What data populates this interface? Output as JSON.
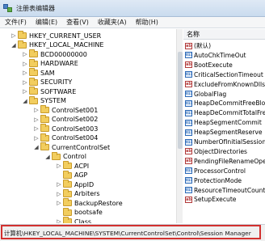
{
  "window": {
    "title": "注册表编辑器"
  },
  "menu": {
    "items": [
      "文件(F)",
      "编辑(E)",
      "查看(V)",
      "收藏夹(A)",
      "帮助(H)"
    ]
  },
  "tree": {
    "items": [
      {
        "label": "HKEY_CURRENT_USER",
        "level": 0,
        "expander": "▷",
        "icon": "folder"
      },
      {
        "label": "HKEY_LOCAL_MACHINE",
        "level": 0,
        "expander": "◢",
        "icon": "folder"
      },
      {
        "label": "BCD00000000",
        "level": 1,
        "expander": "▷",
        "icon": "folder"
      },
      {
        "label": "HARDWARE",
        "level": 1,
        "expander": "▷",
        "icon": "folder"
      },
      {
        "label": "SAM",
        "level": 1,
        "expander": "▷",
        "icon": "folder"
      },
      {
        "label": "SECURITY",
        "level": 1,
        "expander": "▷",
        "icon": "folder"
      },
      {
        "label": "SOFTWARE",
        "level": 1,
        "expander": "▷",
        "icon": "folder"
      },
      {
        "label": "SYSTEM",
        "level": 1,
        "expander": "◢",
        "icon": "folder"
      },
      {
        "label": "ControlSet001",
        "level": 2,
        "expander": "▷",
        "icon": "folder"
      },
      {
        "label": "ControlSet002",
        "level": 2,
        "expander": "▷",
        "icon": "folder"
      },
      {
        "label": "ControlSet003",
        "level": 2,
        "expander": "▷",
        "icon": "folder"
      },
      {
        "label": "ControlSet004",
        "level": 2,
        "expander": "▷",
        "icon": "folder"
      },
      {
        "label": "CurrentControlSet",
        "level": 2,
        "expander": "◢",
        "icon": "folder"
      },
      {
        "label": "Control",
        "level": 3,
        "expander": "◢",
        "icon": "folder"
      },
      {
        "label": "ACPI",
        "level": 4,
        "expander": "▷",
        "icon": "folder"
      },
      {
        "label": "AGP",
        "level": 4,
        "expander": "",
        "icon": "folder"
      },
      {
        "label": "AppID",
        "level": 4,
        "expander": "▷",
        "icon": "folder"
      },
      {
        "label": "Arbiters",
        "level": 4,
        "expander": "▷",
        "icon": "folder"
      },
      {
        "label": "BackupRestore",
        "level": 4,
        "expander": "▷",
        "icon": "folder"
      },
      {
        "label": "bootsafe",
        "level": 4,
        "expander": "",
        "icon": "folder"
      },
      {
        "label": "Class",
        "level": 4,
        "expander": "▷",
        "icon": "folder"
      }
    ]
  },
  "values": {
    "header": "名称",
    "items": [
      {
        "name": "(默认)",
        "type": "ab"
      },
      {
        "name": "AutoChkTimeOut",
        "type": "bin"
      },
      {
        "name": "BootExecute",
        "type": "ab"
      },
      {
        "name": "CriticalSectionTimeout",
        "type": "bin"
      },
      {
        "name": "ExcludeFromKnownDlls",
        "type": "ab"
      },
      {
        "name": "GlobalFlag",
        "type": "bin"
      },
      {
        "name": "HeapDeCommitFreeBlo...",
        "type": "bin"
      },
      {
        "name": "HeapDeCommitTotalFre...",
        "type": "bin"
      },
      {
        "name": "HeapSegmentCommit",
        "type": "bin"
      },
      {
        "name": "HeapSegmentReserve",
        "type": "bin"
      },
      {
        "name": "NumberOfInitialSessions",
        "type": "bin"
      },
      {
        "name": "ObjectDirectories",
        "type": "ab"
      },
      {
        "name": "PendingFileRenameOpe...",
        "type": "ab"
      },
      {
        "name": "ProcessorControl",
        "type": "bin"
      },
      {
        "name": "ProtectionMode",
        "type": "bin"
      },
      {
        "name": "ResourceTimeoutCount",
        "type": "bin"
      },
      {
        "name": "SetupExecute",
        "type": "ab"
      }
    ]
  },
  "status": {
    "path": "计算机\\HKEY_LOCAL_MACHINE\\SYSTEM\\CurrentControlSet\\Control\\Session Manager"
  },
  "colors": {
    "highlight": "#d2312f",
    "folder": "#f2cd5e"
  }
}
